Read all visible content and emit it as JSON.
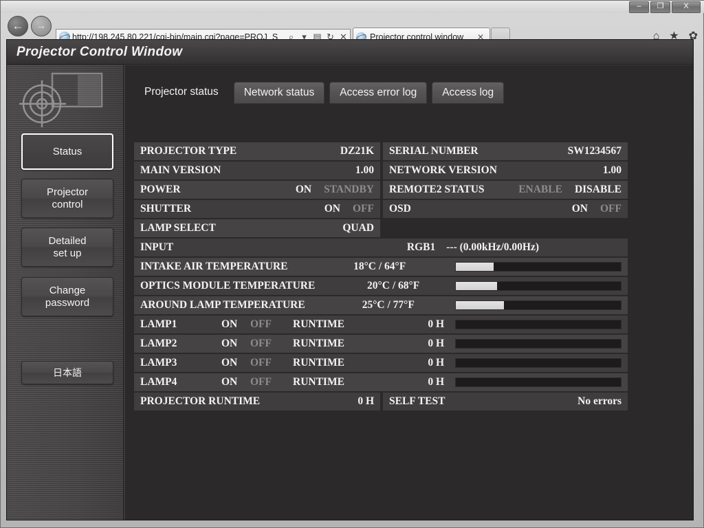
{
  "browser": {
    "window_controls": {
      "minimize": "–",
      "maximize": "❐",
      "close": "X"
    },
    "back_icon": "←",
    "forward_icon": "→",
    "url": "http://198.245.80.221/cgi-bin/main.cgi?page=PROJ_S",
    "address_icons": {
      "search": "⌕",
      "dropdown": "▾",
      "compat": "▤",
      "refresh": "↻",
      "stop": "✕"
    },
    "tab": {
      "title": "Projector control window",
      "close": "✕"
    },
    "toolbar_icons": {
      "home": "⌂",
      "favorites": "★",
      "settings": "✿"
    }
  },
  "page": {
    "title": "Projector Control Window"
  },
  "sidebar": {
    "buttons": [
      {
        "label": "Status",
        "active": true
      },
      {
        "label": "Projector\ncontrol",
        "active": false
      },
      {
        "label": "Detailed\nset up",
        "active": false
      },
      {
        "label": "Change\npassword",
        "active": false
      }
    ],
    "language_button": "日本語"
  },
  "tabs": [
    {
      "label": "Projector status",
      "active": true
    },
    {
      "label": "Network status",
      "active": false
    },
    {
      "label": "Access error log",
      "active": false
    },
    {
      "label": "Access log",
      "active": false
    }
  ],
  "status": {
    "projector_type": {
      "label": "PROJECTOR TYPE",
      "value": "DZ21K"
    },
    "serial_number": {
      "label": "SERIAL NUMBER",
      "value": "SW1234567"
    },
    "main_version": {
      "label": "MAIN VERSION",
      "value": "1.00"
    },
    "network_version": {
      "label": "NETWORK VERSION",
      "value": "1.00"
    },
    "power": {
      "label": "POWER",
      "on": "ON",
      "standby": "STANDBY",
      "selected": "ON"
    },
    "remote2_status": {
      "label": "REMOTE2 STATUS",
      "enable": "ENABLE",
      "disable": "DISABLE",
      "selected": "DISABLE"
    },
    "shutter": {
      "label": "SHUTTER",
      "on": "ON",
      "off": "OFF",
      "selected": "ON"
    },
    "osd": {
      "label": "OSD",
      "on": "ON",
      "off": "OFF",
      "selected": "ON"
    },
    "lamp_select": {
      "label": "LAMP SELECT",
      "value": "QUAD"
    },
    "input": {
      "label": "INPUT",
      "signal": "RGB1",
      "frequency": "--- (0.00kHz/0.00Hz)"
    },
    "temperatures": [
      {
        "label": "INTAKE AIR TEMPERATURE",
        "value": "18°C / 64°F",
        "percent": 23
      },
      {
        "label": "OPTICS MODULE TEMPERATURE",
        "value": "20°C / 68°F",
        "percent": 25
      },
      {
        "label": "AROUND LAMP TEMPERATURE",
        "value": "25°C / 77°F",
        "percent": 29
      }
    ],
    "lamps": [
      {
        "label": "LAMP1",
        "on": "ON",
        "off": "OFF",
        "runtime_label": "RUNTIME",
        "runtime": "0 H",
        "percent": 0,
        "selected": "ON"
      },
      {
        "label": "LAMP2",
        "on": "ON",
        "off": "OFF",
        "runtime_label": "RUNTIME",
        "runtime": "0 H",
        "percent": 0,
        "selected": "ON"
      },
      {
        "label": "LAMP3",
        "on": "ON",
        "off": "OFF",
        "runtime_label": "RUNTIME",
        "runtime": "0 H",
        "percent": 0,
        "selected": "ON"
      },
      {
        "label": "LAMP4",
        "on": "ON",
        "off": "OFF",
        "runtime_label": "RUNTIME",
        "runtime": "0 H",
        "percent": 0,
        "selected": "ON"
      }
    ],
    "projector_runtime": {
      "label": "PROJECTOR RUNTIME",
      "value": "0 H"
    },
    "self_test": {
      "label": "SELF TEST",
      "value": "No errors"
    }
  }
}
